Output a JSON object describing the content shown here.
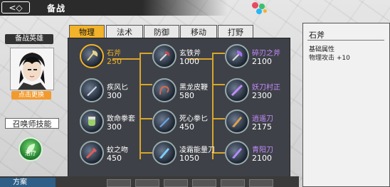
{
  "header": {
    "back_glyph": "<◇",
    "title": "备战"
  },
  "left": {
    "hero_label": "备战英雄",
    "change_hero": "点击更换",
    "spell_label": "召唤师技能",
    "spell_name": "治疗"
  },
  "tabs": [
    {
      "label": "物理",
      "active": true
    },
    {
      "label": "法术",
      "active": false
    },
    {
      "label": "防御",
      "active": false
    },
    {
      "label": "移动",
      "active": false
    },
    {
      "label": "打野",
      "active": false
    }
  ],
  "items": {
    "col1": [
      {
        "name": "石斧",
        "price": "250",
        "selected": true
      },
      {
        "name": "疾风匕",
        "price": "300"
      },
      {
        "name": "致命拳套",
        "price": "300"
      },
      {
        "name": "蚊之吻",
        "price": "450"
      }
    ],
    "col2": [
      {
        "name": "玄铁斧",
        "price": "1000"
      },
      {
        "name": "黑龙皮鞭",
        "price": "580"
      },
      {
        "name": "死心拳匕",
        "price": "450"
      },
      {
        "name": "凌霜能量刀",
        "price": "1050"
      }
    ],
    "col3": [
      {
        "name": "碎刃之斧",
        "price": "2100"
      },
      {
        "name": "妖刀村正",
        "price": "2300"
      },
      {
        "name": "逍遥刀",
        "price": "2175"
      },
      {
        "name": "青阳刀",
        "price": "2100"
      }
    ]
  },
  "detail": {
    "item_name": "石斧",
    "attr_header": "基础属性",
    "stat": "物理攻击 +10"
  },
  "bottom": {
    "tab_label": "方案"
  }
}
